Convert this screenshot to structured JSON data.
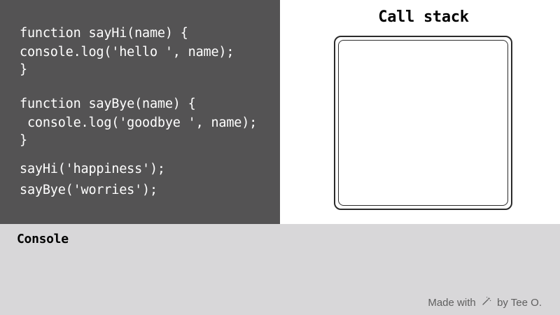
{
  "code": {
    "lines": [
      "function sayHi(name) {",
      "console.log('hello ', name);",
      "}",
      "function sayBye(name) {",
      " console.log('goodbye ', name);",
      "}",
      "sayHi('happiness');",
      "sayBye('worries');"
    ]
  },
  "call_stack": {
    "title": "Call stack",
    "frames": []
  },
  "console": {
    "title": "Console",
    "output": []
  },
  "credit": {
    "prefix": "Made with",
    "icon": "magic-wand-icon",
    "suffix": "by Tee O."
  },
  "colors": {
    "code_bg": "#545354",
    "console_bg": "#d8d7d9",
    "stack_bg": "#ffffff"
  }
}
